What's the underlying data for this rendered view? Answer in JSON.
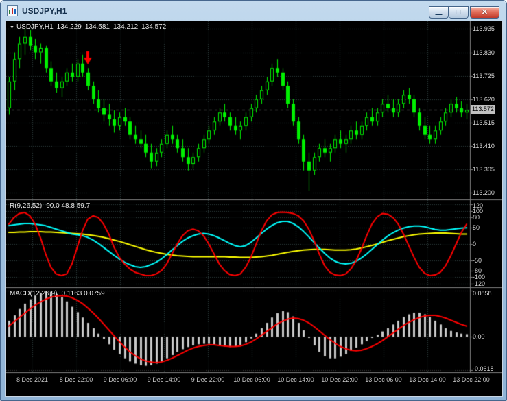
{
  "window": {
    "title": "USDJPY,H1",
    "controls": {
      "minimize": "—",
      "maximize": "□",
      "close": "✕"
    }
  },
  "chart": {
    "header": {
      "expand_icon": "▼",
      "symbol_period": "USDJPY,H1",
      "open": "134.229",
      "high": "134.581",
      "low": "134.212",
      "close": "134.572"
    },
    "price_axis": {
      "labels": [
        "113.935",
        "113.830",
        "113.725",
        "113.620",
        "113.515",
        "113.410",
        "113.305",
        "113.200"
      ],
      "current_price": "113.572"
    },
    "time_axis": {
      "labels": [
        "8 Dec 2021",
        "8 Dec 22:00",
        "9 Dec 06:00",
        "9 Dec 14:00",
        "9 Dec 22:00",
        "10 Dec 06:00",
        "10 Dec 14:00",
        "10 Dec 22:00",
        "13 Dec 06:00",
        "13 Dec 14:00",
        "13 Dec 22:00"
      ]
    },
    "colors": {
      "background": "#000000",
      "grid": "#2f3f3f",
      "separator": "#808080",
      "axis_text": "#d6d6d6",
      "current_price_tag": "#c0c0c0"
    }
  },
  "chart_data": [
    {
      "type": "candlestick",
      "title": "USDJPY,H1",
      "ylim": [
        113.17,
        113.97
      ],
      "colors": {
        "up": "#00f000",
        "down": "#00f000",
        "wick": "#00f000"
      },
      "annotations": [
        {
          "type": "sell-down-arrow",
          "bar": 15,
          "price": 113.78,
          "color": "#ff0000"
        }
      ],
      "ohlc": [
        [
          113.58,
          113.72,
          113.55,
          113.7
        ],
        [
          113.7,
          113.83,
          113.66,
          113.8
        ],
        [
          113.8,
          113.9,
          113.76,
          113.87
        ],
        [
          113.87,
          113.935,
          113.82,
          113.9
        ],
        [
          113.9,
          113.93,
          113.84,
          113.86
        ],
        [
          113.86,
          113.89,
          113.8,
          113.83
        ],
        [
          113.83,
          113.87,
          113.78,
          113.85
        ],
        [
          113.85,
          113.86,
          113.74,
          113.76
        ],
        [
          113.76,
          113.79,
          113.68,
          113.7
        ],
        [
          113.7,
          113.74,
          113.65,
          113.67
        ],
        [
          113.67,
          113.72,
          113.63,
          113.7
        ],
        [
          113.7,
          113.76,
          113.68,
          113.74
        ],
        [
          113.74,
          113.78,
          113.7,
          113.72
        ],
        [
          113.72,
          113.8,
          113.7,
          113.78
        ],
        [
          113.78,
          113.82,
          113.72,
          113.74
        ],
        [
          113.74,
          113.76,
          113.66,
          113.68
        ],
        [
          113.68,
          113.7,
          113.6,
          113.62
        ],
        [
          113.62,
          113.66,
          113.56,
          113.58
        ],
        [
          113.58,
          113.62,
          113.52,
          113.55
        ],
        [
          113.55,
          113.6,
          113.5,
          113.53
        ],
        [
          113.53,
          113.57,
          113.47,
          113.5
        ],
        [
          113.5,
          113.56,
          113.48,
          113.54
        ],
        [
          113.54,
          113.58,
          113.5,
          113.52
        ],
        [
          113.52,
          113.54,
          113.44,
          113.46
        ],
        [
          113.46,
          113.5,
          113.42,
          113.44
        ],
        [
          113.44,
          113.48,
          113.4,
          113.42
        ],
        [
          113.42,
          113.46,
          113.36,
          113.38
        ],
        [
          113.38,
          113.42,
          113.31,
          113.34
        ],
        [
          113.34,
          113.4,
          113.32,
          113.38
        ],
        [
          113.38,
          113.44,
          113.36,
          113.42
        ],
        [
          113.42,
          113.48,
          113.4,
          113.46
        ],
        [
          113.46,
          113.5,
          113.42,
          113.44
        ],
        [
          113.44,
          113.46,
          113.38,
          113.4
        ],
        [
          113.4,
          113.44,
          113.34,
          113.36
        ],
        [
          113.36,
          113.4,
          113.3,
          113.33
        ],
        [
          113.33,
          113.38,
          113.31,
          113.36
        ],
        [
          113.36,
          113.42,
          113.34,
          113.4
        ],
        [
          113.4,
          113.46,
          113.38,
          113.44
        ],
        [
          113.44,
          113.5,
          113.42,
          113.48
        ],
        [
          113.48,
          113.54,
          113.46,
          113.52
        ],
        [
          113.52,
          113.58,
          113.5,
          113.56
        ],
        [
          113.56,
          113.6,
          113.52,
          113.54
        ],
        [
          113.54,
          113.56,
          113.48,
          113.5
        ],
        [
          113.5,
          113.54,
          113.46,
          113.48
        ],
        [
          113.48,
          113.52,
          113.44,
          113.5
        ],
        [
          113.5,
          113.56,
          113.48,
          113.54
        ],
        [
          113.54,
          113.6,
          113.52,
          113.58
        ],
        [
          113.58,
          113.64,
          113.56,
          113.62
        ],
        [
          113.62,
          113.68,
          113.6,
          113.66
        ],
        [
          113.66,
          113.72,
          113.64,
          113.7
        ],
        [
          113.7,
          113.78,
          113.68,
          113.76
        ],
        [
          113.76,
          113.8,
          113.72,
          113.74
        ],
        [
          113.74,
          113.76,
          113.66,
          113.68
        ],
        [
          113.68,
          113.7,
          113.58,
          113.6
        ],
        [
          113.6,
          113.62,
          113.5,
          113.52
        ],
        [
          113.52,
          113.54,
          113.42,
          113.44
        ],
        [
          113.44,
          113.46,
          113.3,
          113.34
        ],
        [
          113.34,
          113.38,
          113.21,
          113.3
        ],
        [
          113.3,
          113.38,
          113.28,
          113.36
        ],
        [
          113.36,
          113.42,
          113.34,
          113.4
        ],
        [
          113.4,
          113.44,
          113.36,
          113.38
        ],
        [
          113.38,
          113.42,
          113.34,
          113.4
        ],
        [
          113.4,
          113.46,
          113.38,
          113.44
        ],
        [
          113.44,
          113.48,
          113.4,
          113.42
        ],
        [
          113.42,
          113.46,
          113.38,
          113.44
        ],
        [
          113.44,
          113.5,
          113.42,
          113.48
        ],
        [
          113.48,
          113.52,
          113.44,
          113.46
        ],
        [
          113.46,
          113.52,
          113.44,
          113.5
        ],
        [
          113.5,
          113.56,
          113.48,
          113.54
        ],
        [
          113.54,
          113.58,
          113.5,
          113.52
        ],
        [
          113.52,
          113.58,
          113.5,
          113.56
        ],
        [
          113.56,
          113.62,
          113.54,
          113.6
        ],
        [
          113.6,
          113.64,
          113.56,
          113.58
        ],
        [
          113.58,
          113.62,
          113.54,
          113.56
        ],
        [
          113.56,
          113.62,
          113.54,
          113.6
        ],
        [
          113.6,
          113.66,
          113.58,
          113.64
        ],
        [
          113.64,
          113.67,
          113.6,
          113.62
        ],
        [
          113.62,
          113.64,
          113.54,
          113.56
        ],
        [
          113.56,
          113.58,
          113.48,
          113.5
        ],
        [
          113.5,
          113.54,
          113.44,
          113.46
        ],
        [
          113.46,
          113.5,
          113.42,
          113.44
        ],
        [
          113.44,
          113.5,
          113.42,
          113.48
        ],
        [
          113.48,
          113.54,
          113.46,
          113.52
        ],
        [
          113.52,
          113.58,
          113.5,
          113.56
        ],
        [
          113.56,
          113.62,
          113.54,
          113.6
        ],
        [
          113.6,
          113.63,
          113.56,
          113.58
        ],
        [
          113.58,
          113.61,
          113.54,
          113.56
        ],
        [
          113.56,
          113.6,
          113.53,
          113.572
        ]
      ]
    },
    {
      "type": "line",
      "title": "R(9,26,52)",
      "values_label": "90.0 48.8 59.7",
      "ylim": [
        -130,
        130
      ],
      "y_ticks": [
        "120",
        "100",
        "80",
        "50",
        "0",
        "-50",
        "-80",
        "-100",
        "-120"
      ],
      "series": [
        {
          "name": "slow",
          "color": "#ffff00",
          "values": [
            35,
            35,
            36,
            36,
            37,
            37,
            37,
            36,
            36,
            35,
            34,
            33,
            32,
            31,
            30,
            28,
            26,
            23,
            20,
            16,
            12,
            8,
            3,
            -2,
            -7,
            -12,
            -17,
            -21,
            -25,
            -28,
            -31,
            -33,
            -35,
            -36,
            -37,
            -38,
            -38,
            -38,
            -38,
            -38,
            -38,
            -38,
            -39,
            -39,
            -40,
            -40,
            -40,
            -39,
            -38,
            -36,
            -34,
            -31,
            -28,
            -25,
            -22,
            -20,
            -18,
            -17,
            -16,
            -16,
            -16,
            -17,
            -18,
            -18,
            -18,
            -17,
            -15,
            -12,
            -8,
            -4,
            0,
            5,
            10,
            14,
            18,
            22,
            25,
            28,
            30,
            31,
            32,
            33,
            33,
            33,
            32,
            31,
            30,
            30
          ]
        },
        {
          "name": "medium",
          "color": "#00ffff",
          "values": [
            55,
            58,
            60,
            62,
            62,
            60,
            58,
            55,
            50,
            45,
            40,
            35,
            30,
            28,
            25,
            20,
            12,
            2,
            -10,
            -22,
            -34,
            -45,
            -55,
            -62,
            -68,
            -70,
            -68,
            -62,
            -55,
            -45,
            -32,
            -18,
            -5,
            8,
            18,
            25,
            30,
            32,
            30,
            25,
            18,
            10,
            2,
            -5,
            -8,
            -5,
            5,
            18,
            32,
            45,
            56,
            64,
            68,
            68,
            62,
            52,
            38,
            22,
            5,
            -12,
            -28,
            -42,
            -52,
            -58,
            -60,
            -58,
            -52,
            -42,
            -30,
            -16,
            -2,
            12,
            24,
            34,
            42,
            48,
            52,
            54,
            54,
            52,
            48,
            44,
            42,
            42,
            44,
            46,
            48,
            48.8
          ]
        },
        {
          "name": "fast",
          "color": "#ff0000",
          "values": [
            60,
            80,
            92,
            95,
            85,
            60,
            20,
            -30,
            -70,
            -90,
            -95,
            -90,
            -60,
            -10,
            40,
            75,
            85,
            80,
            60,
            30,
            -10,
            -40,
            -60,
            -75,
            -85,
            -90,
            -95,
            -95,
            -90,
            -80,
            -60,
            -30,
            0,
            25,
            40,
            45,
            40,
            25,
            0,
            -30,
            -60,
            -80,
            -92,
            -95,
            -90,
            -70,
            -40,
            0,
            40,
            70,
            88,
            95,
            96,
            95,
            92,
            85,
            70,
            45,
            10,
            -30,
            -65,
            -85,
            -93,
            -95,
            -90,
            -75,
            -50,
            -15,
            25,
            60,
            82,
            92,
            90,
            80,
            60,
            30,
            -5,
            -40,
            -70,
            -88,
            -95,
            -93,
            -85,
            -65,
            -35,
            0,
            35,
            59.7
          ]
        }
      ]
    },
    {
      "type": "macd",
      "title": "MACD(12,26,9)",
      "values_label": "0.1163 0.0759",
      "ylim": [
        -0.066,
        0.09
      ],
      "y_ticks": [
        "0.0858",
        "0.00",
        "-0.0618"
      ],
      "colors": {
        "histogram": "#c8c8c8",
        "signal": "#ff0000"
      },
      "histogram": [
        0.03,
        0.04,
        0.052,
        0.062,
        0.07,
        0.077,
        0.082,
        0.085,
        0.084,
        0.08,
        0.074,
        0.066,
        0.056,
        0.046,
        0.036,
        0.026,
        0.016,
        0.006,
        -0.004,
        -0.014,
        -0.024,
        -0.032,
        -0.04,
        -0.046,
        -0.05,
        -0.053,
        -0.054,
        -0.053,
        -0.05,
        -0.046,
        -0.04,
        -0.034,
        -0.028,
        -0.023,
        -0.019,
        -0.016,
        -0.014,
        -0.013,
        -0.013,
        -0.014,
        -0.016,
        -0.018,
        -0.019,
        -0.018,
        -0.015,
        -0.01,
        -0.003,
        0.006,
        0.016,
        0.026,
        0.036,
        0.044,
        0.048,
        0.046,
        0.038,
        0.026,
        0.012,
        -0.002,
        -0.016,
        -0.028,
        -0.036,
        -0.04,
        -0.04,
        -0.037,
        -0.032,
        -0.026,
        -0.02,
        -0.014,
        -0.008,
        -0.002,
        0.004,
        0.01,
        0.016,
        0.023,
        0.03,
        0.037,
        0.042,
        0.045,
        0.045,
        0.042,
        0.037,
        0.03,
        0.023,
        0.016,
        0.011,
        0.008,
        0.006,
        0.005
      ],
      "signal": [
        0.02,
        0.028,
        0.036,
        0.044,
        0.052,
        0.059,
        0.065,
        0.07,
        0.074,
        0.076,
        0.077,
        0.076,
        0.073,
        0.068,
        0.062,
        0.054,
        0.045,
        0.035,
        0.024,
        0.013,
        0.002,
        -0.009,
        -0.019,
        -0.028,
        -0.035,
        -0.041,
        -0.045,
        -0.047,
        -0.048,
        -0.047,
        -0.044,
        -0.04,
        -0.035,
        -0.03,
        -0.025,
        -0.021,
        -0.018,
        -0.016,
        -0.015,
        -0.015,
        -0.016,
        -0.017,
        -0.018,
        -0.018,
        -0.017,
        -0.014,
        -0.01,
        -0.004,
        0.003,
        0.01,
        0.017,
        0.024,
        0.029,
        0.033,
        0.035,
        0.034,
        0.031,
        0.026,
        0.019,
        0.011,
        0.003,
        -0.005,
        -0.012,
        -0.018,
        -0.022,
        -0.025,
        -0.026,
        -0.025,
        -0.022,
        -0.018,
        -0.013,
        -0.007,
        0.0,
        0.007,
        0.014,
        0.021,
        0.027,
        0.032,
        0.036,
        0.039,
        0.04,
        0.04,
        0.038,
        0.035,
        0.031,
        0.027,
        0.023,
        0.02
      ]
    }
  ]
}
